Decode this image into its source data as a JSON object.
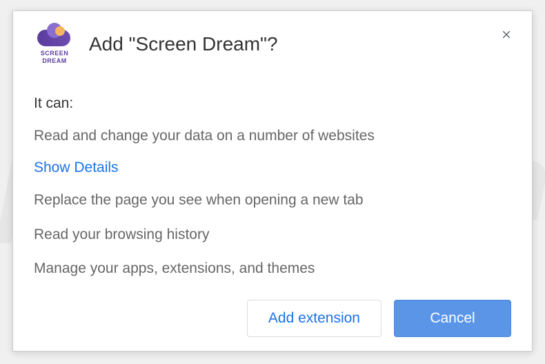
{
  "dialog": {
    "title": "Add \"Screen Dream\"?",
    "extension_brand_line1": "SCREEN",
    "extension_brand_line2": "DREAM",
    "it_can_label": "It can:",
    "permissions": [
      "Read and change your data on a number of websites",
      "Replace the page you see when opening a new tab",
      "Read your browsing history",
      "Manage your apps, extensions, and themes"
    ],
    "show_details_label": "Show Details",
    "add_button_label": "Add extension",
    "cancel_button_label": "Cancel"
  },
  "watermark": "pcrisk.com"
}
